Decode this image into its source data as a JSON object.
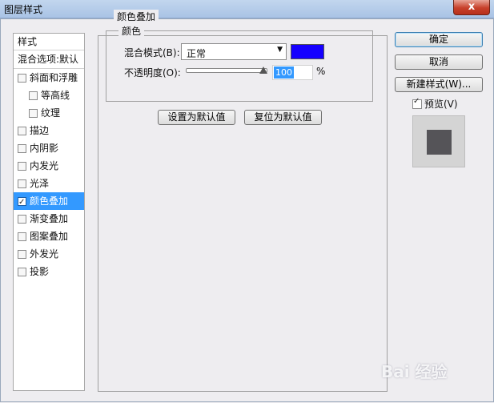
{
  "window": {
    "title": "图层样式",
    "close_symbol": "x"
  },
  "style_list": {
    "header": "样式",
    "blend_options": "混合选项:默认",
    "items": [
      {
        "label": "斜面和浮雕",
        "checked": false,
        "sub": false,
        "selected": false
      },
      {
        "label": "等高线",
        "checked": false,
        "sub": true,
        "selected": false
      },
      {
        "label": "纹理",
        "checked": false,
        "sub": true,
        "selected": false
      },
      {
        "label": "描边",
        "checked": false,
        "sub": false,
        "selected": false
      },
      {
        "label": "内阴影",
        "checked": false,
        "sub": false,
        "selected": false
      },
      {
        "label": "内发光",
        "checked": false,
        "sub": false,
        "selected": false
      },
      {
        "label": "光泽",
        "checked": false,
        "sub": false,
        "selected": false
      },
      {
        "label": "颜色叠加",
        "checked": true,
        "sub": false,
        "selected": true
      },
      {
        "label": "渐变叠加",
        "checked": false,
        "sub": false,
        "selected": false
      },
      {
        "label": "图案叠加",
        "checked": false,
        "sub": false,
        "selected": false
      },
      {
        "label": "外发光",
        "checked": false,
        "sub": false,
        "selected": false
      },
      {
        "label": "投影",
        "checked": false,
        "sub": false,
        "selected": false
      }
    ]
  },
  "panel": {
    "group_title": "颜色叠加",
    "subgroup_title": "颜色",
    "blend_mode_label": "混合模式(B):",
    "blend_mode_value": "正常",
    "overlay_color": "#1500ff",
    "opacity_label": "不透明度(O):",
    "opacity_value": "100",
    "opacity_unit": "%",
    "set_default_label": "设置为默认值",
    "reset_default_label": "复位为默认值"
  },
  "right": {
    "ok_label": "确定",
    "cancel_label": "取消",
    "new_style_label": "新建样式(W)...",
    "preview_label": "预览(V)",
    "preview_checked": true
  },
  "watermark": "Bai 经验"
}
